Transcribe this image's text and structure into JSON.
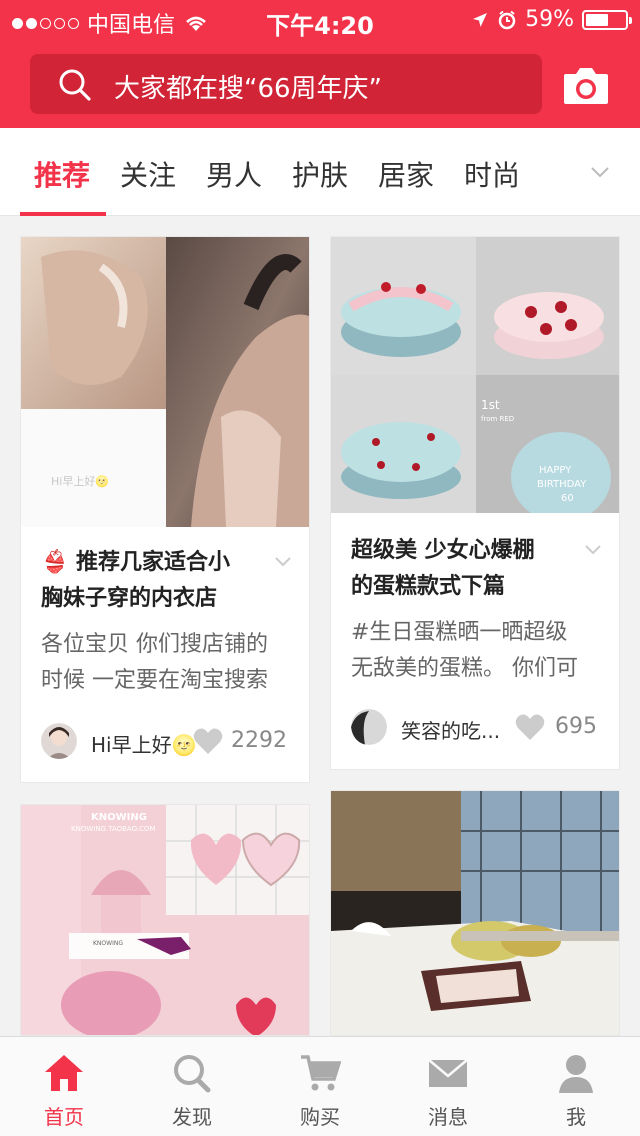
{
  "status_bar": {
    "carrier": "中国电信",
    "time": "下午4:20",
    "battery": "59%",
    "battery_level": 0.59
  },
  "search": {
    "placeholder": "大家都在搜“66周年庆”"
  },
  "tabs": [
    {
      "label": "推荐",
      "active": true
    },
    {
      "label": "关注"
    },
    {
      "label": "男人"
    },
    {
      "label": "护肤"
    },
    {
      "label": "居家"
    },
    {
      "label": "时尚"
    }
  ],
  "cards": [
    {
      "title_line1": "👙 推荐几家适合小",
      "title_line2": "胸妹子穿的内衣店",
      "desc_line1": "各位宝贝 你们搜店铺的",
      "desc_line2": "时候 一定要在淘宝搜索",
      "author": "Hi早上好🌝",
      "likes": "2292",
      "image_caption": "Hi早上好🌝"
    },
    {
      "title_line1": "超级美 少女心爆棚",
      "title_line2": "的蛋糕款式下篇",
      "desc_line1": "#生日蛋糕晒一晒超级",
      "desc_line2": "无敌美的蛋糕。 你们可",
      "author": "笑容的吃...",
      "likes": "695",
      "image_texts": [
        "HAPPY",
        "BIRTHDAY",
        "60",
        "1st",
        "from RED"
      ]
    },
    {
      "image_texts": [
        "KNOWING",
        "KNOWING.TAOBAO.COM",
        "KNOWING"
      ]
    },
    {}
  ],
  "bottom_nav": [
    {
      "label": "首页",
      "icon": "home-icon",
      "active": true
    },
    {
      "label": "发现",
      "icon": "search-icon"
    },
    {
      "label": "购买",
      "icon": "cart-icon"
    },
    {
      "label": "消息",
      "icon": "mail-icon"
    },
    {
      "label": "我",
      "icon": "person-icon"
    }
  ],
  "colors": {
    "brand": "#f2334a",
    "search_bg": "#d12437"
  }
}
